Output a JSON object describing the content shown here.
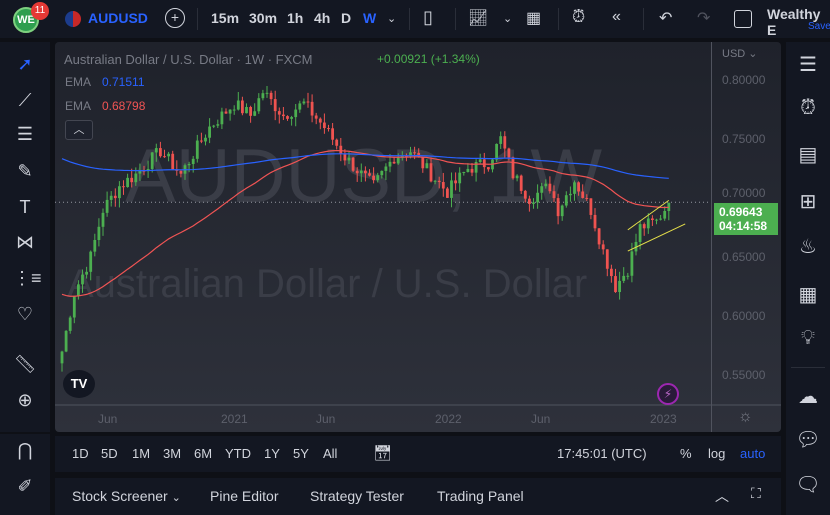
{
  "topbar": {
    "badge": "11",
    "symbol": "AUDUSD",
    "intervals": [
      "15m",
      "30m",
      "1h",
      "4h",
      "D",
      "W"
    ],
    "active_interval": "W",
    "layout_name": "Wealthy E",
    "save_label": "Save"
  },
  "legend": {
    "title": "Australian Dollar / U.S. Dollar · 1W · FXCM",
    "change": "+0.00921 (+1.34%)",
    "ema1_label": "EMA",
    "ema1_value": "0.71511",
    "ema2_label": "EMA",
    "ema2_value": "0.68798"
  },
  "watermark": {
    "line1": "AUDUSD, 1W",
    "line2": "Australian Dollar / U.S. Dollar"
  },
  "price_axis": {
    "currency": "USD",
    "ticks": [
      "0.80000",
      "0.75000",
      "0.70000",
      "0.65000",
      "0.60000",
      "0.55000"
    ],
    "last_price": "0.69643",
    "countdown": "04:14:58"
  },
  "time_axis": {
    "ticks": [
      "Jun",
      "2021",
      "Jun",
      "2022",
      "Jun",
      "2023"
    ]
  },
  "colors": {
    "up": "#26a69a",
    "green": "#4caf50",
    "down": "#ef5350",
    "ema_fast": "#f05454",
    "ema_slow": "#2962ff",
    "trend": "#e6e04a"
  },
  "series": {
    "anchors": [
      [
        0,
        0.57
      ],
      [
        3,
        0.62
      ],
      [
        7,
        0.65
      ],
      [
        10,
        0.69
      ],
      [
        14,
        0.71
      ],
      [
        18,
        0.72
      ],
      [
        24,
        0.74
      ],
      [
        29,
        0.72
      ],
      [
        36,
        0.76
      ],
      [
        42,
        0.78
      ],
      [
        46,
        0.77
      ],
      [
        49,
        0.79
      ],
      [
        54,
        0.77
      ],
      [
        59,
        0.78
      ],
      [
        64,
        0.76
      ],
      [
        69,
        0.735
      ],
      [
        73,
        0.72
      ],
      [
        76,
        0.71
      ],
      [
        81,
        0.735
      ],
      [
        85,
        0.74
      ],
      [
        90,
        0.72
      ],
      [
        94,
        0.705
      ],
      [
        99,
        0.725
      ],
      [
        104,
        0.73
      ],
      [
        107,
        0.75
      ],
      [
        110,
        0.72
      ],
      [
        114,
        0.7
      ],
      [
        119,
        0.71
      ],
      [
        121,
        0.69
      ],
      [
        125,
        0.715
      ],
      [
        129,
        0.69
      ],
      [
        132,
        0.655
      ],
      [
        135,
        0.625
      ],
      [
        138,
        0.64
      ],
      [
        141,
        0.675
      ],
      [
        145,
        0.68
      ],
      [
        148,
        0.696
      ]
    ]
  },
  "timeframes": [
    "1D",
    "5D",
    "1M",
    "3M",
    "6M",
    "YTD",
    "1Y",
    "5Y",
    "All"
  ],
  "clock": "17:45:01 (UTC)",
  "scale_options": [
    "%",
    "log",
    "auto"
  ],
  "bottom_tabs": [
    "Stock Screener",
    "Pine Editor",
    "Strategy Tester",
    "Trading Panel"
  ]
}
